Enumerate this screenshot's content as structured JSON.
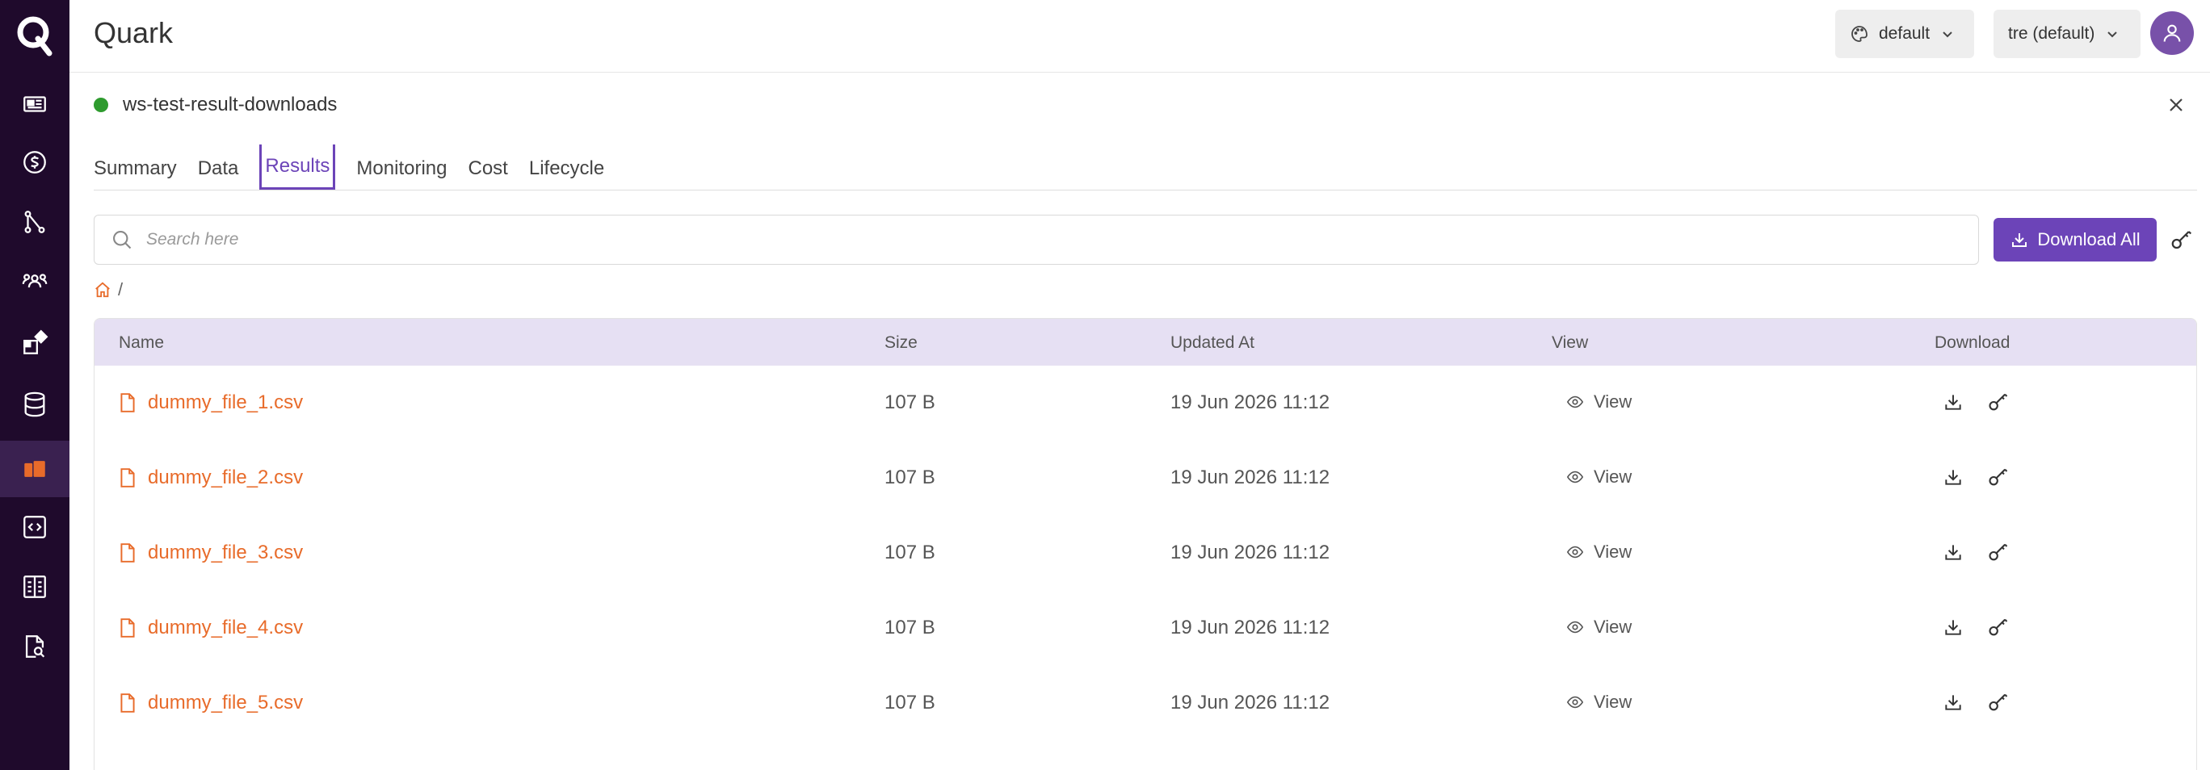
{
  "app": {
    "title": "Quark"
  },
  "header": {
    "theme_select": "default",
    "tenant_select": "tre (default)"
  },
  "workspace": {
    "name": "ws-test-result-downloads",
    "status_color": "#2e9b2e"
  },
  "tabs": [
    {
      "label": "Summary"
    },
    {
      "label": "Data"
    },
    {
      "label": "Results",
      "active": true
    },
    {
      "label": "Monitoring"
    },
    {
      "label": "Cost"
    },
    {
      "label": "Lifecycle"
    }
  ],
  "search": {
    "placeholder": "Search here"
  },
  "toolbar": {
    "download_all_label": "Download All"
  },
  "breadcrumb": {
    "separator": "/"
  },
  "table": {
    "columns": {
      "name": "Name",
      "size": "Size",
      "updated": "Updated At",
      "view": "View",
      "download": "Download"
    },
    "rows": [
      {
        "name": "dummy_file_1.csv",
        "size": "107 B",
        "updated": "19 Jun 2026 11:12",
        "view": "View"
      },
      {
        "name": "dummy_file_2.csv",
        "size": "107 B",
        "updated": "19 Jun 2026 11:12",
        "view": "View"
      },
      {
        "name": "dummy_file_3.csv",
        "size": "107 B",
        "updated": "19 Jun 2026 11:12",
        "view": "View"
      },
      {
        "name": "dummy_file_4.csv",
        "size": "107 B",
        "updated": "19 Jun 2026 11:12",
        "view": "View"
      },
      {
        "name": "dummy_file_5.csv",
        "size": "107 B",
        "updated": "19 Jun 2026 11:12",
        "view": "View"
      }
    ]
  },
  "colors": {
    "accent": "#6c44b8",
    "file_link": "#e86b2a",
    "sidebar_bg": "#1f0a2c",
    "table_header_bg": "#e6e0f3"
  },
  "sidebar": {
    "items": [
      {
        "icon": "news-icon"
      },
      {
        "icon": "dollar-icon"
      },
      {
        "icon": "pipeline-icon"
      },
      {
        "icon": "team-icon"
      },
      {
        "icon": "apps-icon"
      },
      {
        "icon": "database-icon"
      },
      {
        "icon": "workspace-icon",
        "active": true
      },
      {
        "icon": "code-icon"
      },
      {
        "icon": "docs-icon"
      },
      {
        "icon": "search-doc-icon"
      }
    ]
  }
}
